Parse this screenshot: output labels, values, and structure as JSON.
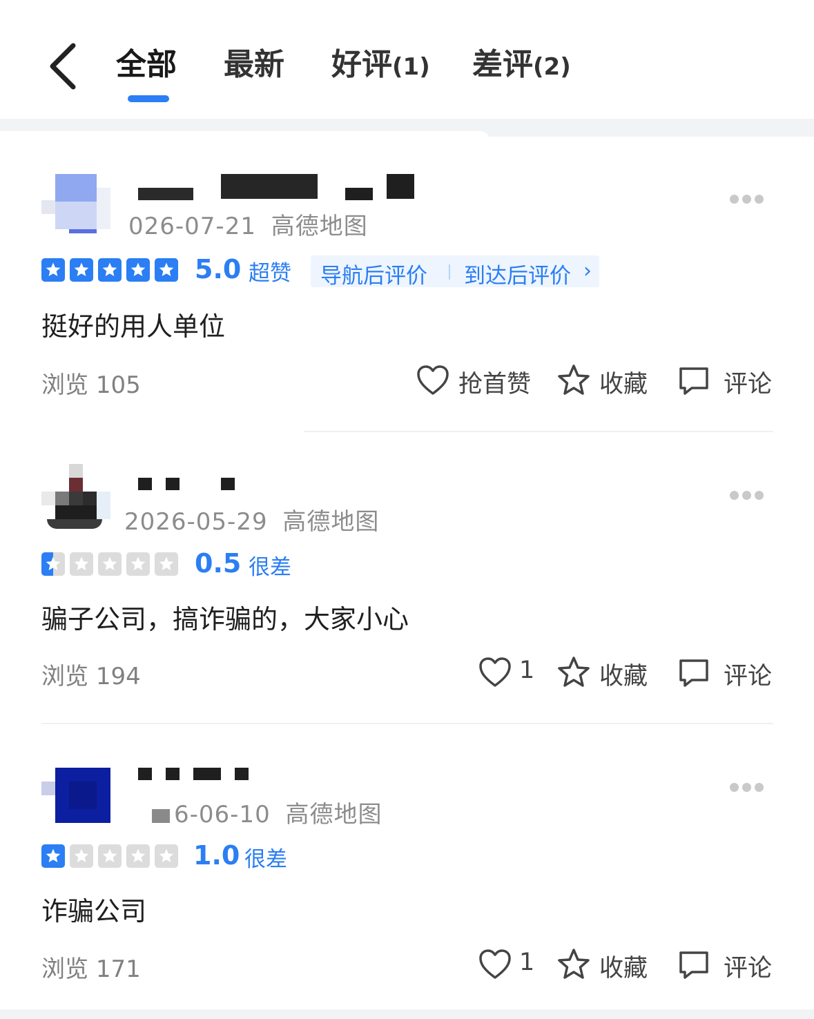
{
  "header": {
    "tabs": [
      {
        "label": "全部",
        "count": ""
      },
      {
        "label": "最新",
        "count": ""
      },
      {
        "label": "好评",
        "count": "(1)"
      },
      {
        "label": "差评",
        "count": "(2)"
      }
    ],
    "active_tab": 0
  },
  "reviews": [
    {
      "date": "026-07-21",
      "source": "高德地图",
      "rating": 5.0,
      "score": "5.0",
      "level": "超赞",
      "nav_tag": {
        "left": "导航后评价",
        "right": "到达后评价"
      },
      "content": "挺好的用人单位",
      "views_label": "浏览",
      "views": "105",
      "like_label": "抢首赞",
      "fav_label": "收藏",
      "comment_label": "评论"
    },
    {
      "date": "2026-05-29",
      "source": "高德地图",
      "rating": 0.5,
      "score": "0.5",
      "level": "很差",
      "content": "骗子公司，搞诈骗的，大家小心",
      "views_label": "浏览",
      "views": "194",
      "like_label": "1",
      "fav_label": "收藏",
      "comment_label": "评论"
    },
    {
      "date": "6-06-10",
      "source": "高德地图",
      "rating": 1.0,
      "score": "1.0",
      "level": "很差",
      "content": "诈骗公司",
      "views_label": "浏览",
      "views": "171",
      "like_label": "1",
      "fav_label": "收藏",
      "comment_label": "评论"
    }
  ],
  "colors": {
    "accent": "#2b7ef3",
    "star_empty": "#dcdcdc",
    "muted": "#8c8c8c"
  },
  "icons": [
    "back-chevron-icon",
    "more-dots-icon",
    "star-icon",
    "heart-icon",
    "star-outline-icon",
    "comment-icon",
    "chevron-right-icon"
  ]
}
